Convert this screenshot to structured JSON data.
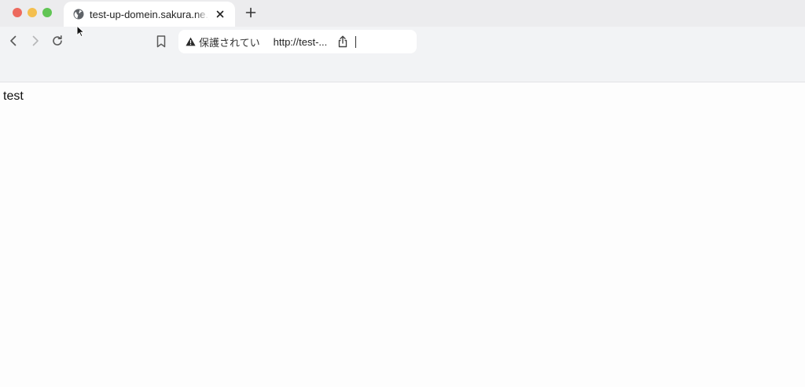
{
  "window": {
    "controls": [
      "close",
      "minimize",
      "maximize"
    ]
  },
  "tab": {
    "title": "test-up-domein.sakura.ne.jp/",
    "favicon": "globe-icon",
    "close_icon": "close-icon"
  },
  "new_tab_icon": "plus-icon",
  "toolbar": {
    "back_icon": "chevron-left-icon",
    "forward_icon": "chevron-right-icon",
    "reload_icon": "reload-icon",
    "bookmark_icon": "bookmark-icon"
  },
  "address_bar": {
    "security_icon": "warning-icon",
    "security_label": "保護されてい",
    "url": "http://test-...",
    "share_icon": "share-icon"
  },
  "page": {
    "body_text": "test"
  },
  "colors": {
    "close": "#ed6a5e",
    "minimize": "#f4bf4f",
    "maximize": "#61c554",
    "tabbar_bg": "#ececee",
    "toolbar_bg": "#f2f3f5"
  }
}
